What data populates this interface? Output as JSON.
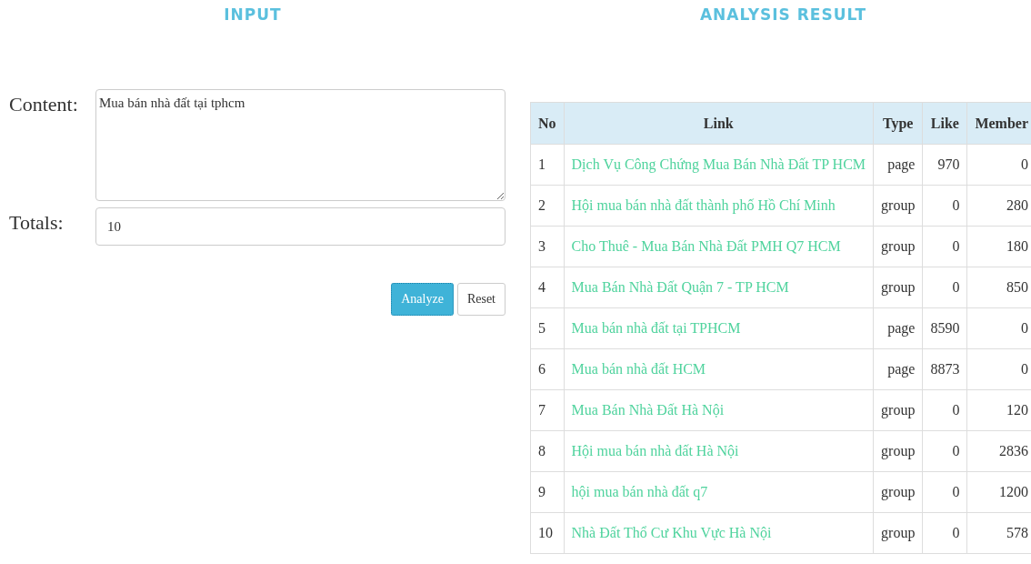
{
  "input": {
    "heading": "INPUT",
    "content_label": "Content:",
    "content_value": "Mua bán nhà đất tại tphcm",
    "totals_label": "Totals:",
    "totals_value": "10",
    "buttons": [
      {
        "label": "Analyze",
        "kind": "primary"
      },
      {
        "label": "Reset",
        "kind": "default"
      }
    ]
  },
  "result": {
    "heading": "ANALYSIS RESULT",
    "columns": [
      "No",
      "Link",
      "Type",
      "Like",
      "Member"
    ],
    "rows": [
      {
        "no": "1",
        "link": "Dịch Vụ Công Chứng Mua Bán Nhà Đất TP HCM",
        "type": "page",
        "like": "970",
        "member": "0"
      },
      {
        "no": "2",
        "link": "Hội mua bán nhà đất thành phố Hồ Chí Minh",
        "type": "group",
        "like": "0",
        "member": "280"
      },
      {
        "no": "3",
        "link": "Cho Thuê - Mua Bán Nhà Đất PMH Q7 HCM",
        "type": "group",
        "like": "0",
        "member": "180"
      },
      {
        "no": "4",
        "link": "Mua Bán Nhà Đất Quận 7 - TP HCM",
        "type": "group",
        "like": "0",
        "member": "850"
      },
      {
        "no": "5",
        "link": "Mua bán nhà đất tại TPHCM",
        "type": "page",
        "like": "8590",
        "member": "0"
      },
      {
        "no": "6",
        "link": "Mua bán nhà đất HCM",
        "type": "page",
        "like": "8873",
        "member": "0"
      },
      {
        "no": "7",
        "link": "Mua Bán Nhà Đất Hà Nội",
        "type": "group",
        "like": "0",
        "member": "120"
      },
      {
        "no": "8",
        "link": "Hội mua bán nhà đất Hà Nội",
        "type": "group",
        "like": "0",
        "member": "2836"
      },
      {
        "no": "9",
        "link": "hội mua bán nhà đất q7",
        "type": "group",
        "like": "0",
        "member": "1200"
      },
      {
        "no": "10",
        "link": "Nhà Đất Thổ Cư Khu Vực Hà Nội",
        "type": "group",
        "like": "0",
        "member": "578"
      }
    ]
  }
}
